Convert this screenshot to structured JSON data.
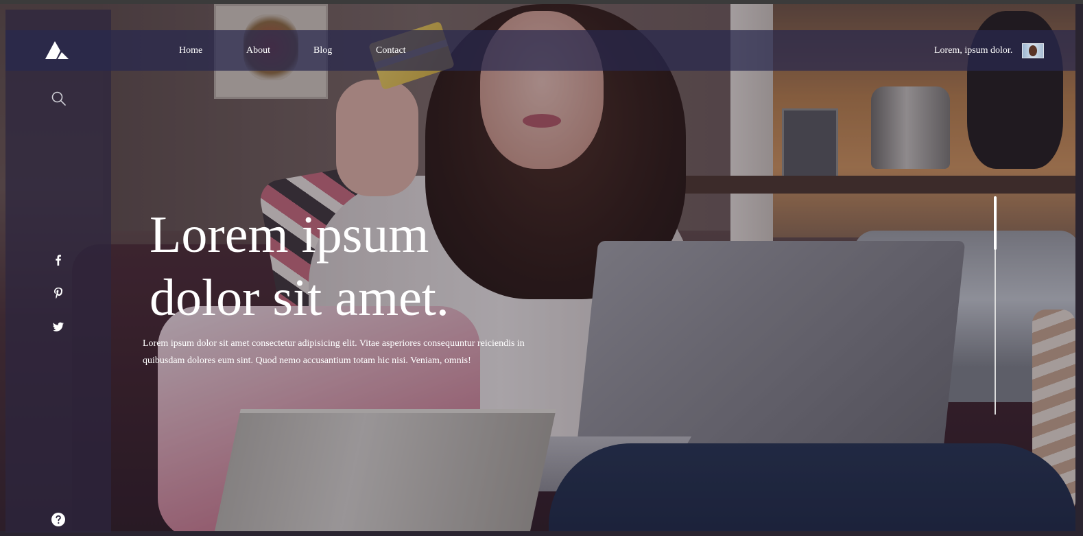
{
  "nav": {
    "links": [
      {
        "label": "Home"
      },
      {
        "label": "About"
      },
      {
        "label": "Blog"
      },
      {
        "label": "Contact"
      }
    ],
    "user_label": "Lorem, ipsum dolor."
  },
  "hero": {
    "headline_line1": "Lorem ipsum",
    "headline_line2": "dolor sit amet.",
    "description": "Lorem ipsum dolor sit amet consectetur adipisicing elit. Vitae asperiores consequuntur reiciendis in quibusdam dolores eum sint. Quod nemo accusantium totam hic nisi. Veniam, omnis!"
  },
  "sidebar": {
    "icons": [
      "logo-icon",
      "search-icon",
      "facebook-icon",
      "pinterest-icon",
      "twitter-icon",
      "help-icon"
    ]
  },
  "colors": {
    "nav_bar": "#28284e",
    "sidebar": "#2c263e",
    "text": "#ffffff"
  }
}
